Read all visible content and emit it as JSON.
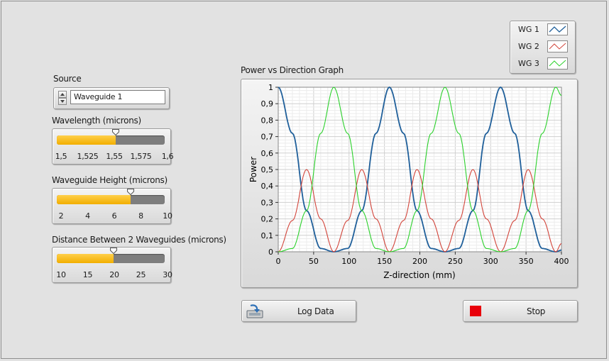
{
  "source": {
    "label": "Source",
    "value": "Waveguide 1"
  },
  "wavelength": {
    "label": "Wavelength (microns)",
    "ticks": [
      "1,5",
      "1,525",
      "1,55",
      "1,575",
      "1,6"
    ],
    "min": 1.5,
    "max": 1.6,
    "value": 1.551
  },
  "height": {
    "label": "Waveguide Height (microns)",
    "ticks": [
      "2",
      "4",
      "6",
      "8",
      "10"
    ],
    "min": 2,
    "max": 10,
    "value": 7.2
  },
  "distance": {
    "label": "Distance Between 2 Waveguides (microns)",
    "ticks": [
      "10",
      "15",
      "20",
      "25",
      "30"
    ],
    "min": 10,
    "max": 30,
    "value": 19.9
  },
  "graph": {
    "title": "Power vs Direction Graph"
  },
  "legend": [
    {
      "name": "WG 1",
      "color": "#1f5f9a"
    },
    {
      "name": "WG 2",
      "color": "#d2443a"
    },
    {
      "name": "WG 3",
      "color": "#2bd12b"
    }
  ],
  "buttons": {
    "log_label": "Log Data",
    "stop_label": "Stop",
    "stop_color": "#e8000b"
  },
  "chart_data": {
    "type": "line",
    "title": "Power vs Direction Graph",
    "xlabel": "Z-direction (mm)",
    "ylabel": "Power",
    "xlim": [
      0,
      400
    ],
    "ylim": [
      0,
      1
    ],
    "x_ticks": [
      "0",
      "50",
      "100",
      "150",
      "200",
      "250",
      "300",
      "350",
      "400"
    ],
    "y_ticks": [
      "0",
      "0,1",
      "0,2",
      "0,3",
      "0,4",
      "0,5",
      "0,6",
      "0,7",
      "0,8",
      "0,9",
      "1"
    ],
    "grid": true,
    "legend_position": "top-right",
    "period_mm": 157,
    "x": [
      0,
      20,
      40,
      60,
      78.5,
      98,
      118,
      138,
      157,
      177,
      196,
      216,
      235.5,
      255,
      275,
      294,
      314,
      334,
      353,
      373,
      392,
      400
    ],
    "series": [
      {
        "name": "WG 1",
        "color": "#1f5f9a",
        "values": [
          1,
          0.72,
          0.25,
          0.02,
          0,
          0.02,
          0.25,
          0.72,
          1,
          0.72,
          0.25,
          0.02,
          0,
          0.02,
          0.25,
          0.72,
          1,
          0.72,
          0.25,
          0.02,
          0,
          0.01
        ]
      },
      {
        "name": "WG 2",
        "color": "#d2443a",
        "values": [
          0,
          0.19,
          0.5,
          0.2,
          0,
          0.19,
          0.5,
          0.2,
          0,
          0.19,
          0.5,
          0.2,
          0,
          0.19,
          0.5,
          0.2,
          0,
          0.19,
          0.5,
          0.2,
          0,
          0.05
        ]
      },
      {
        "name": "WG 3",
        "color": "#2bd12b",
        "values": [
          0,
          0.02,
          0.25,
          0.72,
          1,
          0.72,
          0.25,
          0.02,
          0,
          0.02,
          0.25,
          0.72,
          1,
          0.72,
          0.25,
          0.02,
          0,
          0.02,
          0.25,
          0.72,
          1,
          0.95
        ]
      }
    ]
  }
}
